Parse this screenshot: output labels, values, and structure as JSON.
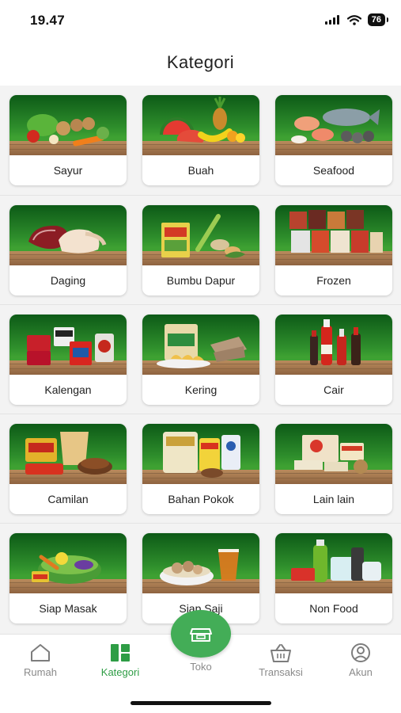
{
  "status_bar": {
    "time": "19.47",
    "battery": "76"
  },
  "header": {
    "title": "Kategori"
  },
  "categories": [
    {
      "label": "Sayur",
      "icon": "vegetables-image"
    },
    {
      "label": "Buah",
      "icon": "fruits-image"
    },
    {
      "label": "Seafood",
      "icon": "seafood-image"
    },
    {
      "label": "Daging",
      "icon": "meat-image"
    },
    {
      "label": "Bumbu Dapur",
      "icon": "spices-image"
    },
    {
      "label": "Frozen",
      "icon": "frozen-food-image"
    },
    {
      "label": "Kalengan",
      "icon": "canned-food-image"
    },
    {
      "label": "Kering",
      "icon": "dried-food-image"
    },
    {
      "label": "Cair",
      "icon": "liquid-sauce-image"
    },
    {
      "label": "Camilan",
      "icon": "snacks-image"
    },
    {
      "label": "Bahan Pokok",
      "icon": "staples-image"
    },
    {
      "label": "Lain lain",
      "icon": "others-image"
    },
    {
      "label": "Siap Masak",
      "icon": "ready-to-cook-image"
    },
    {
      "label": "Siap Saji",
      "icon": "ready-to-eat-image"
    },
    {
      "label": "Non Food",
      "icon": "non-food-image"
    }
  ],
  "bottom_nav": {
    "items": [
      {
        "label": "Rumah",
        "icon": "home-icon"
      },
      {
        "label": "Kategori",
        "icon": "grid-icon",
        "active": true
      },
      {
        "label": "Toko",
        "icon": "store-icon"
      },
      {
        "label": "Transaksi",
        "icon": "basket-icon"
      },
      {
        "label": "Akun",
        "icon": "account-icon"
      }
    ]
  },
  "colors": {
    "accent": "#43ad57",
    "active_text": "#2e9d45",
    "card_bg_top": "#0d5a17",
    "shelf": "#a87a50"
  }
}
